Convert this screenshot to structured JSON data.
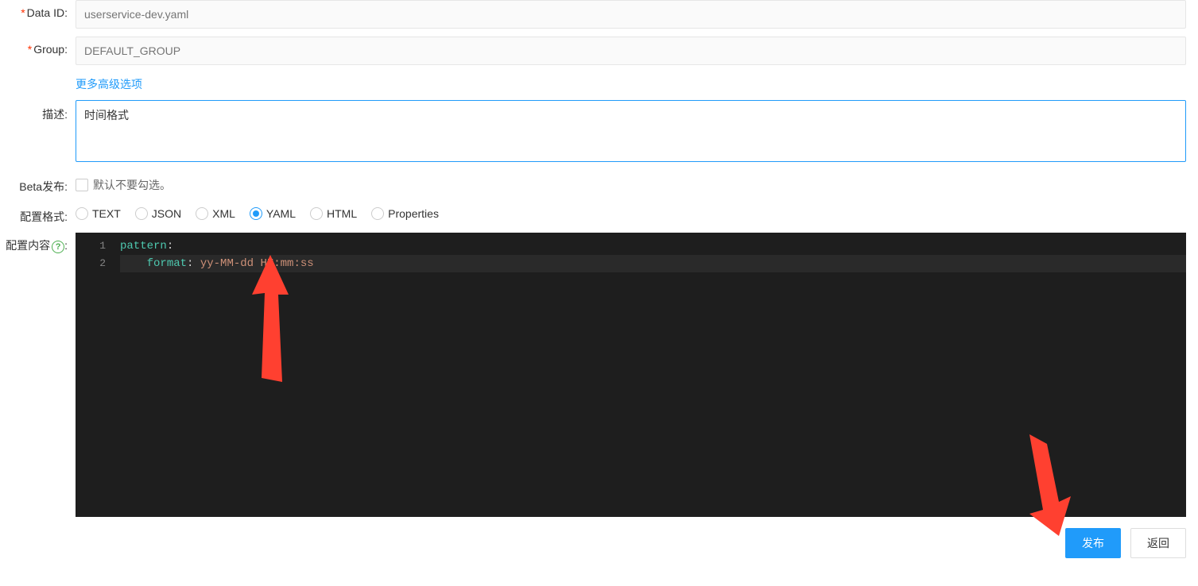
{
  "form": {
    "dataId": {
      "label": "Data ID:",
      "placeholder": "userservice-dev.yaml"
    },
    "group": {
      "label": "Group:",
      "placeholder": "DEFAULT_GROUP"
    },
    "moreOptions": "更多高级选项",
    "description": {
      "label": "描述:",
      "value": "时间格式"
    },
    "beta": {
      "label": "Beta发布:",
      "hint": "默认不要勾选。"
    },
    "format": {
      "label": "配置格式:",
      "options": [
        "TEXT",
        "JSON",
        "XML",
        "YAML",
        "HTML",
        "Properties"
      ],
      "selected": "YAML"
    },
    "content": {
      "label": "配置内容",
      "labelColon": ":",
      "lines": [
        {
          "num": "1",
          "key": "pattern",
          "colon": ":",
          "rest": ""
        },
        {
          "num": "2",
          "indent": "    ",
          "key": "format",
          "colon": ": ",
          "rest": "yy-MM-dd HH:mm:ss"
        }
      ]
    }
  },
  "buttons": {
    "publish": "发布",
    "back": "返回"
  }
}
